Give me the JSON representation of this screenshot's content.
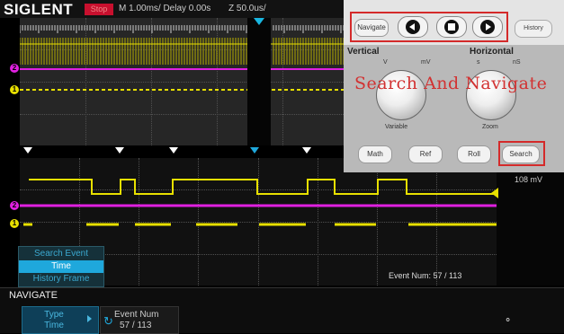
{
  "header": {
    "brand": "SIGLENT",
    "run_state": "Stop",
    "timebase": "M 1.00ms/ Delay 0.00s",
    "zoom_timebase": "Z 50.0us/"
  },
  "colors": {
    "ch1": "#e8e000",
    "ch2": "#e020e0",
    "accent": "#1fa8dc",
    "highlight": "#d42a2a",
    "stop": "#c8102e"
  },
  "channels": [
    {
      "label": "2",
      "color": "#e020e0"
    },
    {
      "label": "1",
      "color": "#e8e000"
    }
  ],
  "waveform": {
    "vertical_scale": "108 mV"
  },
  "search_panel": {
    "items": [
      "Search Event",
      "Time",
      "History Frame"
    ],
    "selected": "Time"
  },
  "event_status": "Event Num: 57 / 113",
  "softkeys": {
    "menu_title": "NAVIGATE",
    "type_label": "Type",
    "type_value": "Time",
    "event_num_label": "Event Num",
    "event_num_value": "57 / 113"
  },
  "front_panel": {
    "overlay_title": "Search And Navigate",
    "navigate_btn": "Navigate",
    "history_btn": "History",
    "vertical_label": "Vertical",
    "horizontal_label": "Horizontal",
    "variable_label": "Variable",
    "zoom_label": "Zoom",
    "math_btn": "Math",
    "ref_btn": "Ref",
    "roll_btn": "Roll",
    "search_btn": "Search",
    "v_marker": "V",
    "mv_marker": "mV",
    "ns_marker": "nS",
    "s_marker": "s"
  }
}
